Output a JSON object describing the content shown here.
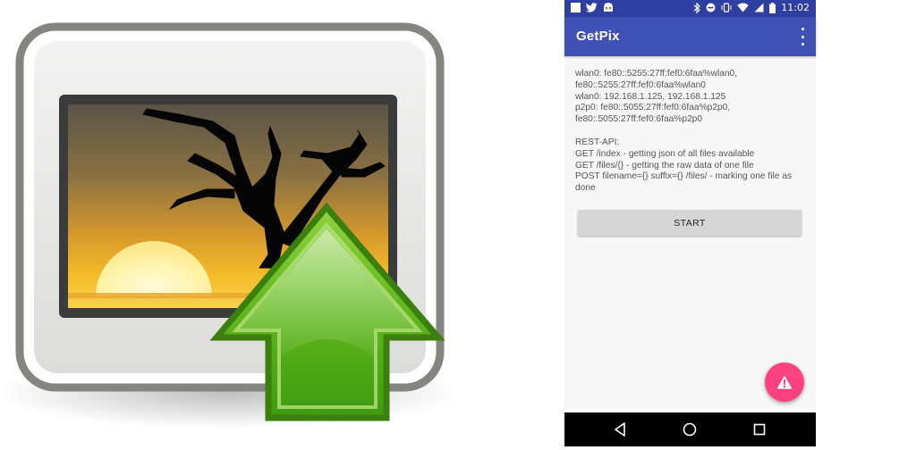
{
  "colors": {
    "status_bar": "#2f3fa1",
    "app_bar": "#3f51b5",
    "fab": "#ff4081",
    "button": "#d6d6d6",
    "nav_bar": "#000000"
  },
  "status_bar": {
    "left_icons": [
      "square-notification-icon",
      "twitter-icon",
      "android-icon"
    ],
    "right_icons": [
      "bluetooth-icon",
      "do-not-disturb-icon",
      "vibrate-icon",
      "wifi-icon",
      "signal-icon",
      "battery-icon"
    ],
    "time": "11:02"
  },
  "app_bar": {
    "title": "GetPix",
    "menu_icon": "overflow-menu-icon"
  },
  "info": {
    "lines": [
      "wlan0: fe80::5255:27ff:fef0:6faa%wlan0,",
      "fe80::5255:27ff:fef0:6faa%wlan0",
      "wlan0: 192.168.1.125, 192.168.1.125",
      "p2p0: fe80::5055:27ff:fef0:6faa%p2p0,",
      "fe80::5055:27ff:fef0:6faa%p2p0"
    ],
    "api_lines": [
      "REST-API:",
      "GET /index - getting json of all files available",
      "GET /files/{} - getting the raw data of one file",
      "POST filename={} suffix={} /files/ - marking one file as done"
    ]
  },
  "start_button": {
    "label": "START"
  },
  "fab": {
    "icon": "warning-icon"
  },
  "nav_bar": {
    "icons": [
      "back-icon",
      "home-icon",
      "recents-icon"
    ]
  },
  "logo": {
    "icon": "image-upload-icon"
  }
}
